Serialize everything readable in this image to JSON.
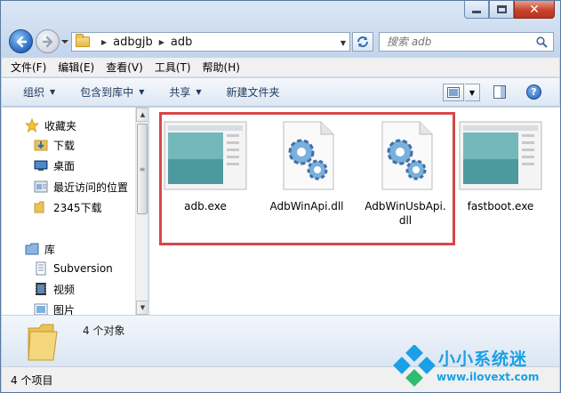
{
  "window": {
    "buttons": {
      "minimize": "minimize",
      "maximize": "maximize",
      "close": "close"
    }
  },
  "address": {
    "crumbs": [
      "adbgjb",
      "adb"
    ],
    "search_placeholder": "搜索 adb"
  },
  "menu": [
    "文件(F)",
    "编辑(E)",
    "查看(V)",
    "工具(T)",
    "帮助(H)"
  ],
  "toolbar": {
    "organize": "组织",
    "include_in_library": "包含到库中",
    "share": "共享",
    "new_folder": "新建文件夹"
  },
  "nav": {
    "favorites": "收藏夹",
    "items": [
      "下载",
      "桌面",
      "最近访问的位置",
      "2345下载"
    ],
    "library": "库",
    "library_items": [
      "Subversion",
      "视频",
      "图片"
    ]
  },
  "files": [
    {
      "name": "adb.exe",
      "icon": "exe-window-icon"
    },
    {
      "name": "AdbWinApi.dll",
      "icon": "dll-gears-icon"
    },
    {
      "name": "AdbWinUsbApi.dll",
      "icon": "dll-gears-icon"
    },
    {
      "name": "fastboot.exe",
      "icon": "exe-window-icon"
    }
  ],
  "details": {
    "count": "4 个对象"
  },
  "status": {
    "text": "4 个项目"
  },
  "watermark": {
    "title": "小小系统迷",
    "url": "www.ilovext.com"
  },
  "colors": {
    "highlight": "#d8464a",
    "accent": "#1aa0e6"
  }
}
